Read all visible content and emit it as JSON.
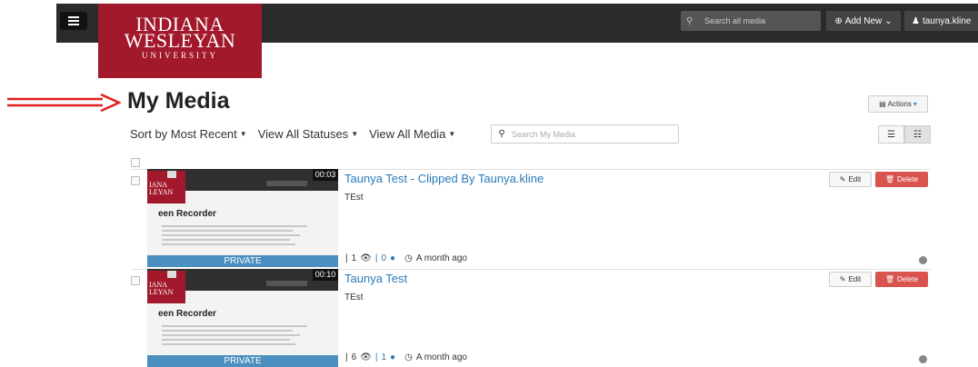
{
  "header": {
    "logo": {
      "line1": "INDIANA",
      "line2": "WESLEYAN",
      "line3": "UNIVERSITY"
    },
    "search_placeholder": "Search all media",
    "add_new_label": "Add New",
    "user_label": "taunya.kline"
  },
  "page": {
    "title": "My Media",
    "actions_label": "Actions"
  },
  "filters": {
    "sort": "Sort by Most Recent",
    "statuses": "View All Statuses",
    "media": "View All Media",
    "search_placeholder": "Search My Media"
  },
  "entries": [
    {
      "title": "Taunya Test - Clipped By Taunya.kline",
      "description": "TEst",
      "duration": "00:03",
      "thumb_title": "een Recorder",
      "thumb_logo_1": "IANA",
      "thumb_logo_2": "LEYAN",
      "privacy": "PRIVATE",
      "plays": "1",
      "comments": "0",
      "time": "A month ago",
      "edit_label": "Edit",
      "delete_label": "Delete"
    },
    {
      "title": "Taunya Test",
      "description": "TEst",
      "duration": "00:10",
      "thumb_title": "een Recorder",
      "thumb_logo_1": "IANA",
      "thumb_logo_2": "LEYAN",
      "privacy": "PRIVATE",
      "plays": "6",
      "comments": "1",
      "time": "A month ago",
      "edit_label": "Edit",
      "delete_label": "Delete"
    }
  ],
  "colors": {
    "brand": "#a3192c",
    "link": "#2a7ab8",
    "delete": "#d9534f",
    "arrow": "#e02020"
  }
}
